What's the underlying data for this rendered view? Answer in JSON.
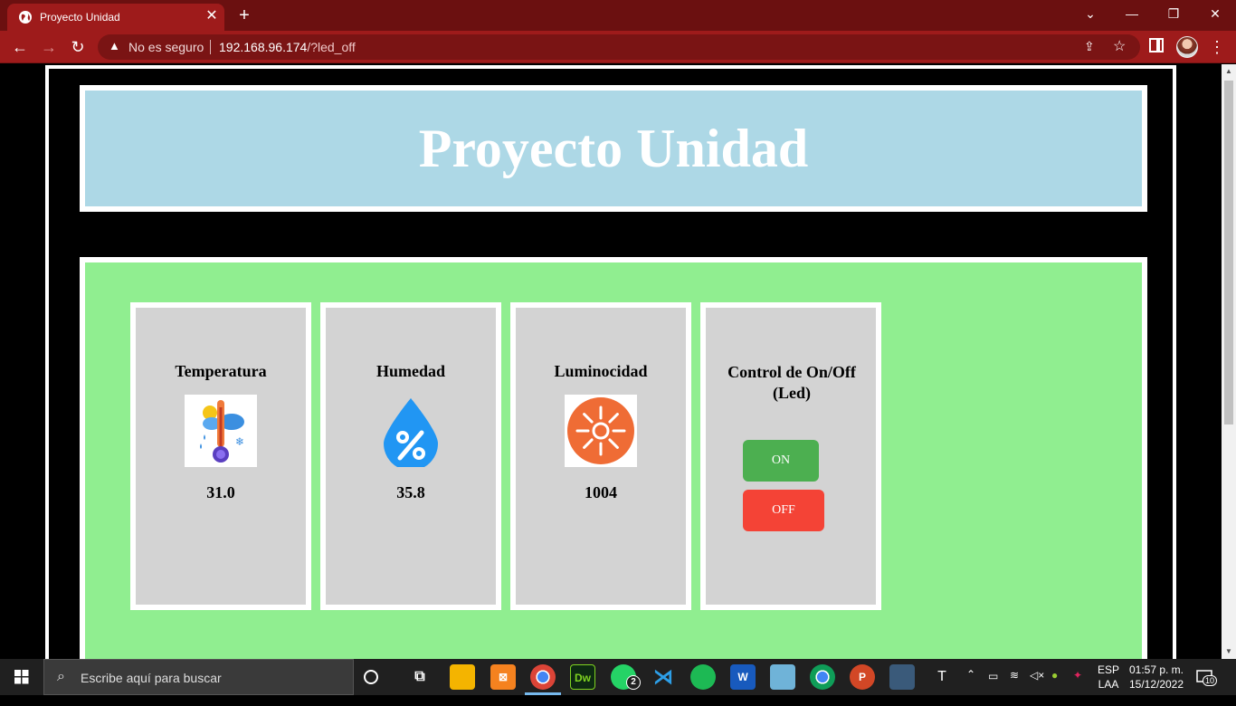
{
  "browser": {
    "tab_title": "Proyecto Unidad",
    "tab_close": "✕",
    "new_tab": "+",
    "security_label": "No es seguro",
    "url_host": "192.168.96.174",
    "url_path": "/?led_off",
    "window_controls": {
      "minimize": "—",
      "maximize": "❐",
      "close": "✕",
      "tabs_dropdown": "⌄"
    }
  },
  "page": {
    "title": "Proyecto Unidad",
    "cards": [
      {
        "label": "Temperatura",
        "value": "31.0",
        "icon": "thermometer-icon"
      },
      {
        "label": "Humedad",
        "value": "35.8",
        "icon": "humidity-drop-icon"
      },
      {
        "label": "Luminocidad",
        "value": "1004",
        "icon": "sun-icon"
      }
    ],
    "control": {
      "label": "Control de On/Off (Led)",
      "on_label": "ON",
      "off_label": "OFF"
    },
    "colors": {
      "header_bg": "#add8e6",
      "panel_bg": "#90ee90",
      "card_bg": "#d3d3d3",
      "on": "#4caf50",
      "off": "#f44336"
    }
  },
  "taskbar": {
    "search_placeholder": "Escribe aquí para buscar",
    "whatsapp_badge": "2",
    "lang_top": "ESP",
    "lang_bottom": "LAA",
    "time": "01:57 p. m.",
    "date": "15/12/2022",
    "notifications": "10",
    "apps": [
      "task-view-icon",
      "file-explorer-icon",
      "xampp-icon",
      "chrome-icon",
      "dreamweaver-icon",
      "whatsapp-icon",
      "vscode-icon",
      "spotify-icon",
      "word-icon",
      "mysql-workbench-icon",
      "chrome-icon",
      "powerpoint-icon",
      "network-icon",
      "typora-icon"
    ]
  }
}
